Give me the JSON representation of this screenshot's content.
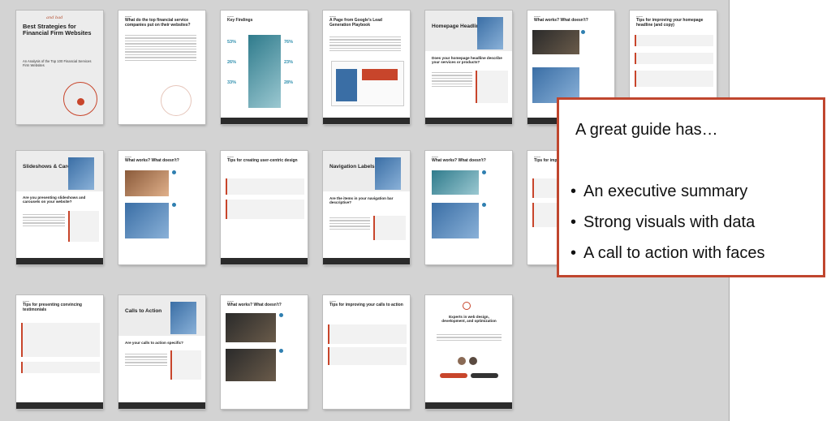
{
  "pages": {
    "p1": {
      "title": "Best Strategies for Financial Firm Websites",
      "handwriting": "and bad",
      "subtitle": "An Analysis of the Top 100 Financial Services Firm Websites"
    },
    "p2": {
      "title": "What do the top financial service companies put on their websites?"
    },
    "p3": {
      "title": "Key Findings",
      "stats": [
        "53%",
        "26%",
        "33%",
        "76%",
        "23%",
        "28%"
      ]
    },
    "p4": {
      "title": "A Page from Google's Lead Generation Playbook"
    },
    "p5": {
      "title": "Homepage Headline",
      "question": "Does your homepage headline describe your services or products?"
    },
    "p6": {
      "title": "What works? What doesn't?"
    },
    "p7": {
      "title": "Tips for improving your homepage headline (and copy)"
    },
    "p8": {
      "title": "Slideshows & Carousels",
      "question": "Are you presenting slideshows and carousels on your website?"
    },
    "p9": {
      "title": "What works? What doesn't?"
    },
    "p10": {
      "title": "Tips for creating user-centric design"
    },
    "p11": {
      "title": "Navigation Labels",
      "question": "Are the items in your navigation bar descriptive?"
    },
    "p12": {
      "title": "What works? What doesn't?"
    },
    "p13": {
      "title": "Tips for imp… navigation"
    },
    "p14": {
      "title": "Tips for presenting convincing testimonials"
    },
    "p15": {
      "title": "Calls to Action",
      "question": "Are your calls to action specific?"
    },
    "p16": {
      "title": "What works? What doesn't?"
    },
    "p17": {
      "title": "Tips for improving your calls to action"
    },
    "p18": {
      "title": "Experts in web design, development, and optimization"
    }
  },
  "callout": {
    "title": "A great guide has…",
    "items": [
      "An executive summary",
      "Strong visuals with data",
      "A call to action with faces"
    ],
    "bullet": "•",
    "border_color": "#c0462e"
  },
  "accent_color": "#c8452b"
}
